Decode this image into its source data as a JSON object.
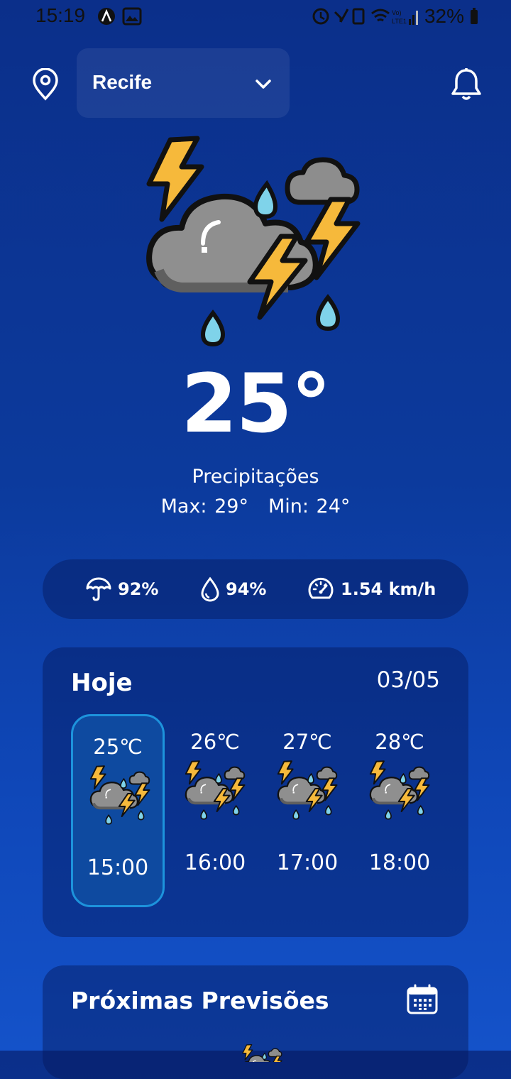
{
  "status_bar": {
    "time": "15:19",
    "battery": "32%"
  },
  "header": {
    "city": "Recife"
  },
  "current": {
    "temperature": "25°",
    "condition": "Precipitações",
    "max": "Max: 29°",
    "min": "Min: 24°"
  },
  "stats": {
    "rain_chance": "92%",
    "humidity": "94%",
    "wind": "1.54 km/h"
  },
  "today": {
    "title": "Hoje",
    "date": "03/05",
    "hours": [
      {
        "temp": "25℃",
        "time": "15:00",
        "selected": true
      },
      {
        "temp": "26℃",
        "time": "16:00"
      },
      {
        "temp": "27℃",
        "time": "17:00"
      },
      {
        "temp": "28℃",
        "time": "18:00"
      }
    ]
  },
  "next": {
    "title": "Próximas Previsões"
  },
  "icons": {
    "location": "location-pin-icon",
    "chevron": "chevron-down-icon",
    "bell": "bell-icon",
    "weather": "thunderstorm-icon",
    "umbrella": "umbrella-icon",
    "drop": "humidity-drop-icon",
    "gauge": "wind-gauge-icon",
    "calendar": "calendar-icon"
  },
  "colors": {
    "selected_border": "#1d93dc",
    "bolt": "#f6b93b",
    "drop": "#7fd3ea",
    "cloud": "#8d8d8d"
  }
}
